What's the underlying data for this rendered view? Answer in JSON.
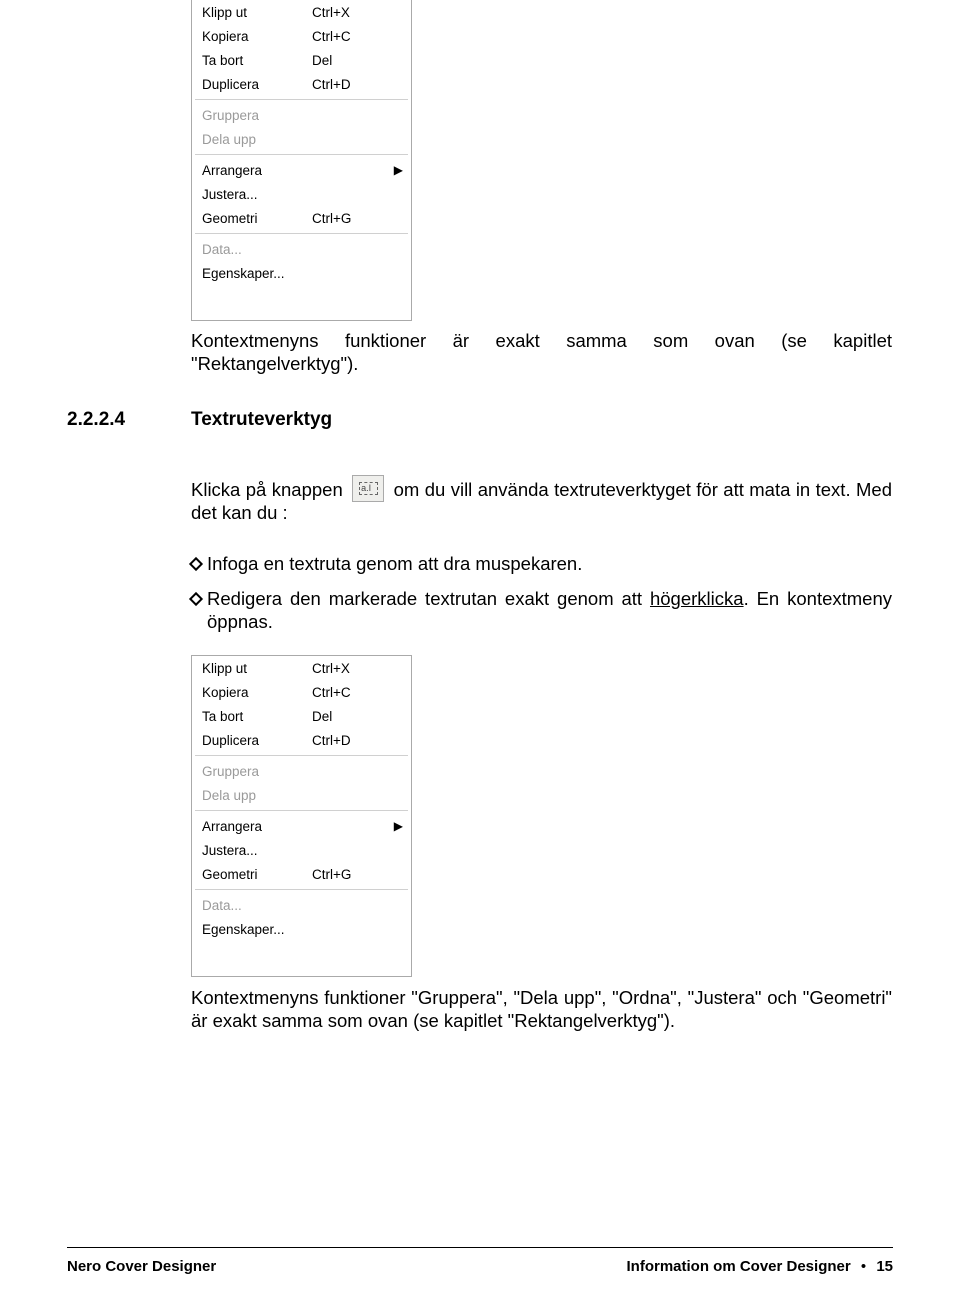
{
  "menu": {
    "group1": [
      {
        "label": "Klipp ut",
        "shortcut": "Ctrl+X"
      },
      {
        "label": "Kopiera",
        "shortcut": "Ctrl+C"
      },
      {
        "label": "Ta bort",
        "shortcut": "Del"
      },
      {
        "label": "Duplicera",
        "shortcut": "Ctrl+D"
      }
    ],
    "group2": [
      {
        "label": "Gruppera"
      },
      {
        "label": "Dela upp"
      }
    ],
    "group3": [
      {
        "label": "Arrangera",
        "submenu": true
      },
      {
        "label": "Justera...",
        "shortcut": ""
      },
      {
        "label": "Geometri",
        "shortcut": "Ctrl+G"
      }
    ],
    "group4": [
      {
        "label": "Data...",
        "disabled": true
      },
      {
        "label": "Egenskaper..."
      }
    ]
  },
  "para1": "Kontextmenyns funktioner är exakt samma som ovan (se kapitlet \"Rektangelverktyg\").",
  "section_no": "2.2.2.4",
  "section_title": "Textruteverktyg",
  "p2a": "Klicka på knappen ",
  "p2b": " om du vill använda textruteverktyget för att mata in text. Med det kan du :",
  "tool_icon_text": "a.I",
  "bullet1": "Infoga en textruta genom att dra muspekaren.",
  "bullet2a": "Redigera den markerade textrutan exakt genom att ",
  "bullet2_ul": "högerklicka",
  "bullet2b": ". En kontextmeny öppnas.",
  "para_last": "Kontextmenyns funktioner \"Gruppera\", \"Dela upp\", \"Ordna\", \"Justera\" och \"Geometri\" är exakt samma som ovan (se kapitlet \"Rektangelverktyg\").",
  "footer_left": "Nero Cover Designer",
  "footer_right_a": "Information om Cover Designer",
  "footer_right_b": "15"
}
